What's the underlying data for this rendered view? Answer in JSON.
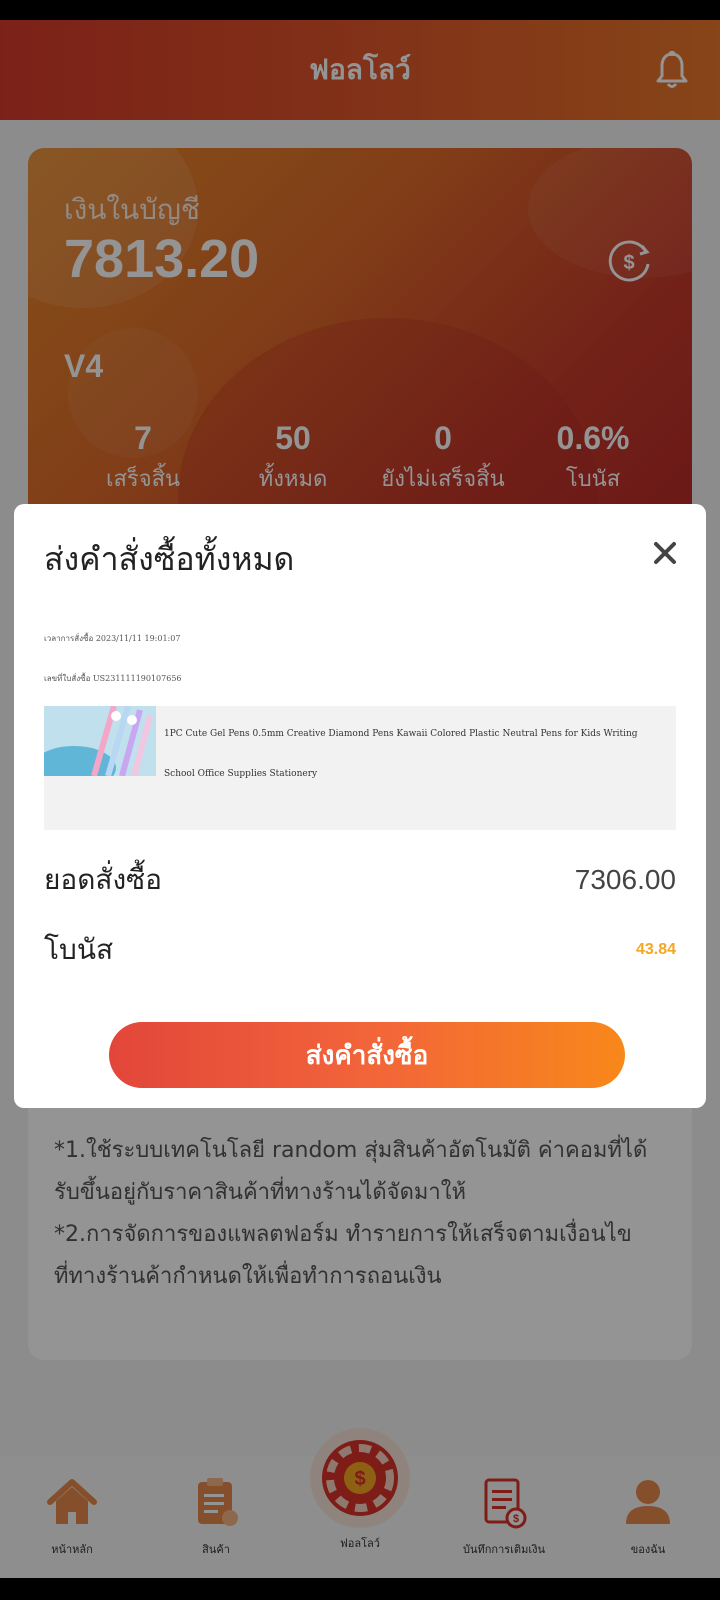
{
  "header": {
    "title": "ฟอลโลว์"
  },
  "account": {
    "label": "เงินในบัญชี",
    "balance": "7813.20",
    "vip_level": "V4",
    "stats": [
      {
        "value": "7",
        "label": "เสร็จสิ้น"
      },
      {
        "value": "50",
        "label": "ทั้งหมด"
      },
      {
        "value": "0",
        "label": "ยังไม่เสร็จสิ้น"
      },
      {
        "value": "0.6%",
        "label": "โบนัส"
      }
    ]
  },
  "info": {
    "lines": [
      "*1.ใช้ระบบเทคโนโลยี random สุ่มสินค้าอัตโนมัติ ค่าคอมที่ได้",
      "รับขึ้นอยู่กับราคาสินค้าที่ทางร้านได้จัดมาให้",
      "*2.การจัดการของแพลตฟอร์ม ทำรายการให้เสร็จตามเงื่อนไข",
      "ที่ทางร้านค้ากำหนดให้เพื่อทำการถอนเงิน"
    ]
  },
  "modal": {
    "title": "ส่งคำสั่งซื้อทั้งหมด",
    "order_time": "เวลาการสั่งซื้อ 2023/11/11 19:01:07",
    "order_no": "เลขที่ใบสั่งซื้อ US231111190107656",
    "product_name": "1PC Cute Gel Pens 0.5mm Creative Diamond Pens Kawaii Colored Plastic Neutral Pens for Kids Writing School Office Supplies Stationery",
    "amount_label": "ยอดสั่งซื้อ",
    "amount_value": "7306.00",
    "bonus_label": "โบนัส",
    "bonus_value": "43.84",
    "submit_label": "ส่งคำสั่งซื้อ"
  },
  "tabbar": {
    "items": [
      {
        "label": "หน้าหลัก",
        "icon": "home-icon"
      },
      {
        "label": "สินค้า",
        "icon": "clipboard-icon"
      },
      {
        "label": "ฟอลโลว์",
        "icon": "spin-wheel-icon"
      },
      {
        "label": "บันทึกการเติมเงิน",
        "icon": "receipt-icon"
      },
      {
        "label": "ของฉัน",
        "icon": "user-icon"
      }
    ]
  },
  "colors": {
    "accent": "#e0562a",
    "bonus": "#f5a623",
    "icon": "#e7894c"
  }
}
